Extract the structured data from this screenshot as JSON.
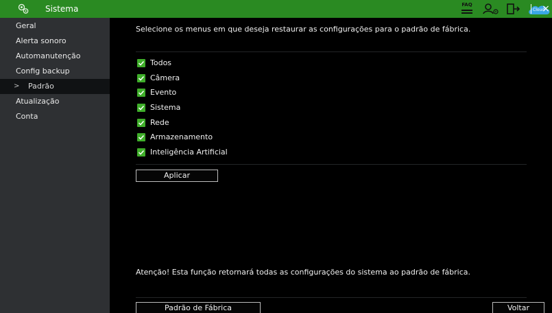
{
  "titlebar": {
    "title": "Sistema",
    "icons": [
      "settings-gear-icon",
      "faq-icon",
      "user-icon",
      "logout-icon",
      "cloud-icon",
      "close-icon"
    ],
    "faq_label": "FAQ",
    "cloud_label": "Cloud",
    "close_glyph": "×",
    "color": "#2a8a22"
  },
  "sidebar": {
    "items": [
      {
        "label": "Geral"
      },
      {
        "label": "Alerta sonoro"
      },
      {
        "label": "Automanutenção"
      },
      {
        "label": "Config backup"
      },
      {
        "label": "Padrão",
        "active": true
      },
      {
        "label": "Atualização"
      },
      {
        "label": "Conta"
      }
    ],
    "active_arrow": ">"
  },
  "main": {
    "instruction": "Selecione os menus em que deseja restaurar as configurações para o padrão de fábrica.",
    "options": [
      {
        "label": "Todos",
        "checked": true
      },
      {
        "label": "Câmera",
        "checked": true
      },
      {
        "label": "Evento",
        "checked": true
      },
      {
        "label": "Sistema",
        "checked": true
      },
      {
        "label": "Rede",
        "checked": true
      },
      {
        "label": "Armazenamento",
        "checked": true
      },
      {
        "label": "Inteligência Artificial",
        "checked": true
      }
    ],
    "apply_button": "Aplicar",
    "warning": "Atenção! Esta função retornará todas as configurações do sistema ao padrão de fábrica.",
    "factory_button": "Padrão de Fábrica",
    "back_button": "Voltar",
    "check_color": "#3fae2a"
  }
}
